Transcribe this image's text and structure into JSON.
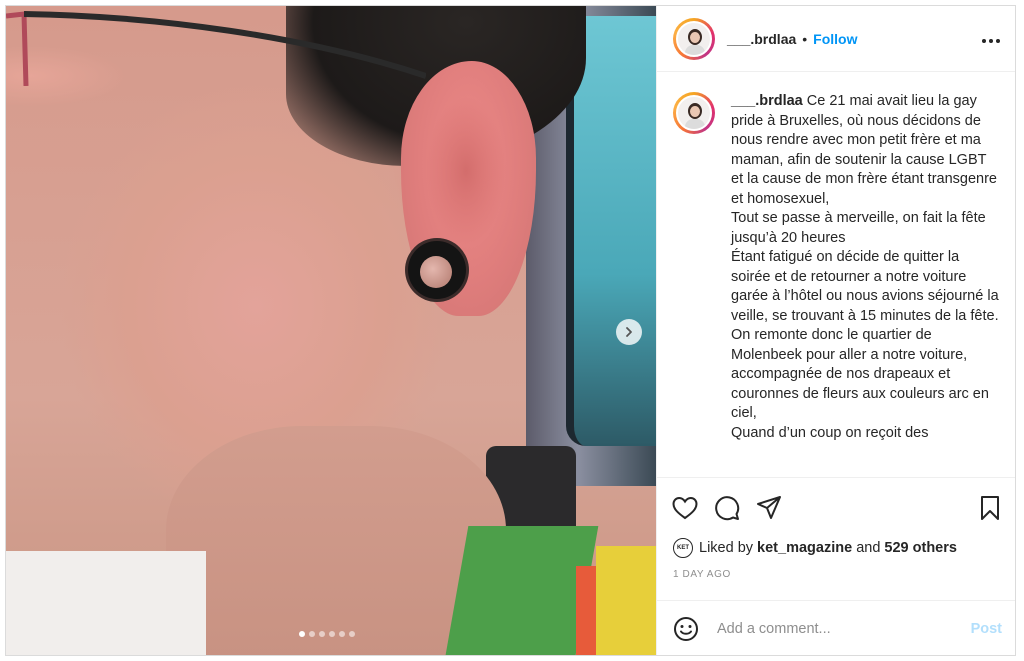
{
  "post": {
    "carousel": {
      "slide_count": 6,
      "active_index": 0
    },
    "header": {
      "username": "___.brdlaa",
      "separator": "•",
      "follow_label": "Follow",
      "more_label": "•••"
    },
    "caption": {
      "username": "___.brdlaa",
      "text": "Ce 21 mai avait lieu la gay pride à Bruxelles, où nous décidons de nous rendre avec mon petit frère et ma maman, afin de soutenir la cause LGBT et la cause de mon frère étant transgenre et homosexuel,\nTout se passe à merveille, on fait la fête jusqu’à 20 heures\nÉtant fatigué on décide de quitter la soirée et de retourner a notre voiture garée à l’hôtel ou nous avions séjourné la veille, se trouvant à 15 minutes de la fête.\nOn remonte donc le quartier de Molenbeek pour aller a notre voiture, accompagnée de nos drapeaux et couronnes de fleurs aux couleurs arc en ciel,\nQuand d’un coup on reçoit des"
    },
    "likes": {
      "liker_badge": "KET",
      "prefix": "Liked by",
      "liker": "ket_magazine",
      "conjunction": "and",
      "others": "529 others"
    },
    "timestamp": "1 DAY AGO",
    "comment": {
      "placeholder": "Add a comment...",
      "post_label": "Post"
    },
    "icons": {
      "like": "heart-icon",
      "comment": "comment-icon",
      "share": "share-icon",
      "save": "bookmark-icon",
      "emoji": "emoji-icon",
      "next": "chevron-right-icon"
    },
    "colors": {
      "accent": "#0095f6",
      "post_disabled": "#b2dffc",
      "muted": "#8e8e8e"
    }
  }
}
